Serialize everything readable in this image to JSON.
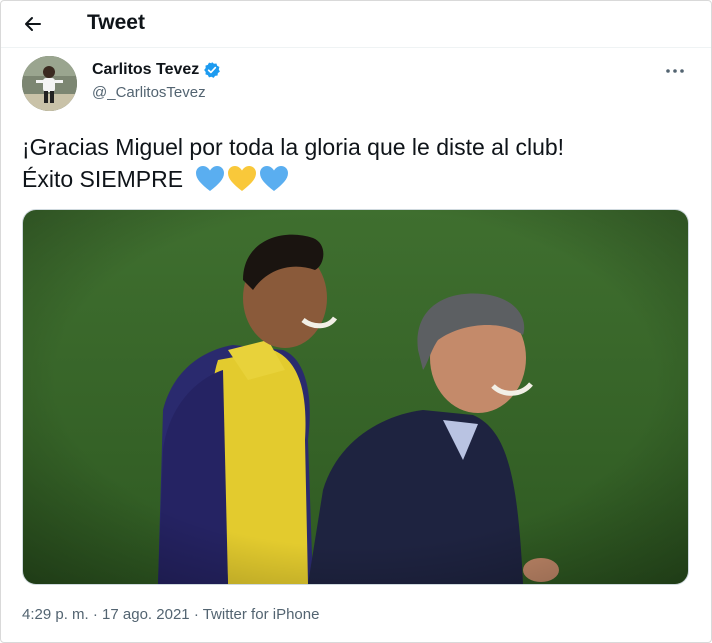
{
  "header": {
    "back_icon": "arrow-left-icon",
    "title": "Tweet"
  },
  "author": {
    "display_name": "Carlitos Tevez",
    "handle": "@_CarlitosTevez",
    "verified": true,
    "verified_color": "#1d9bf0"
  },
  "tweet": {
    "text_line1": "¡Gracias Miguel por toda la gloria que le diste al club!",
    "text_line2": "Éxito SIEMPRE",
    "emojis": [
      "blue-heart",
      "yellow-heart",
      "blue-heart"
    ],
    "emoji_colors": [
      "#5aaef0",
      "#f9c83a",
      "#5aaef0"
    ]
  },
  "media": {
    "description_icon": "photo-image"
  },
  "meta": {
    "time": "4:29 p. m.",
    "separator": "·",
    "date": "17 ago. 2021",
    "source": "Twitter for iPhone"
  },
  "colors": {
    "text": "#0f1419",
    "secondary": "#536471",
    "pitch": "#3b6a2c"
  }
}
